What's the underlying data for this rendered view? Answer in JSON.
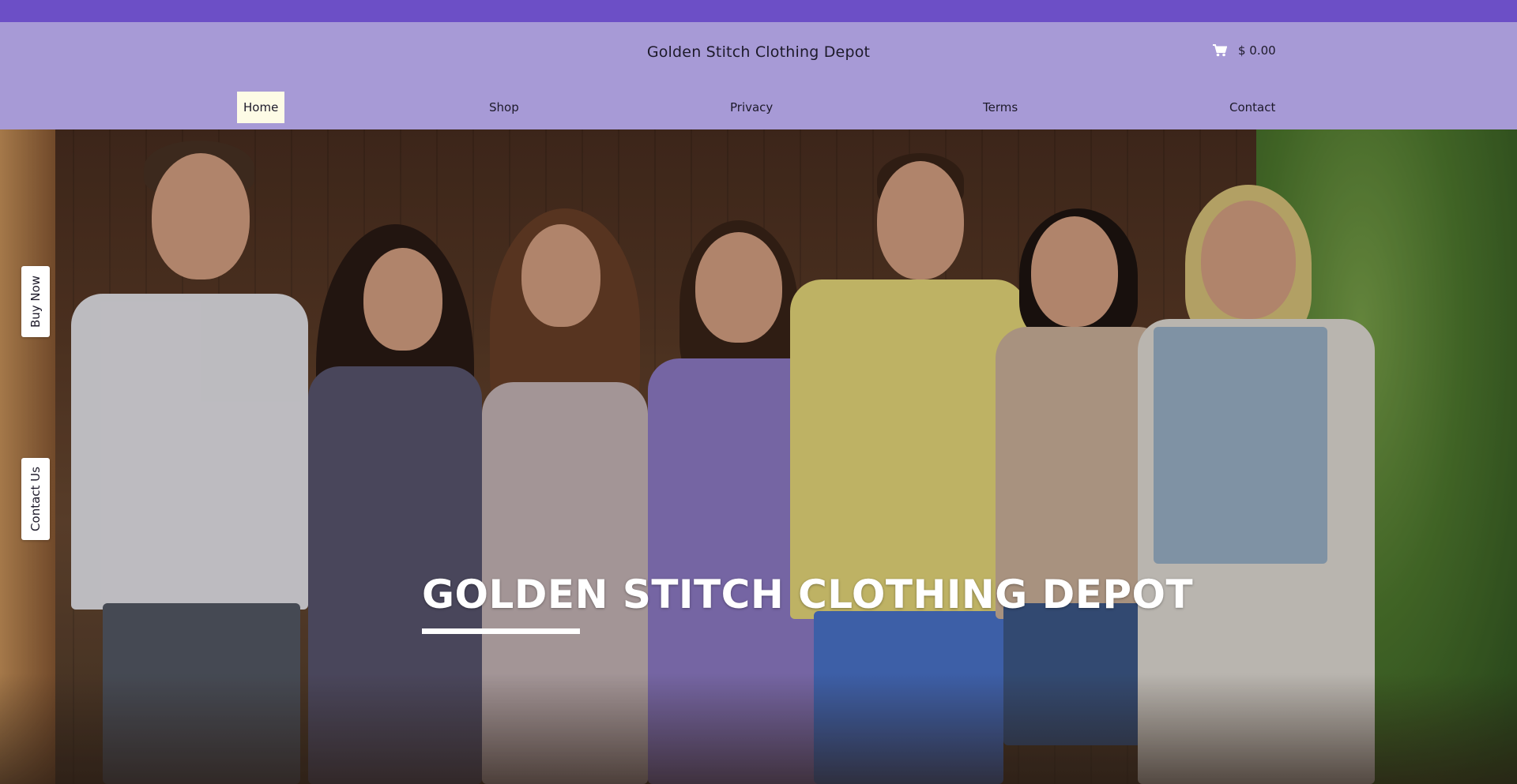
{
  "header": {
    "brand": "Golden Stitch Clothing Depot",
    "cart_total": "$ 0.00",
    "cart_icon": "shopping-cart-icon"
  },
  "nav": {
    "items": [
      {
        "label": "Home",
        "active": true
      },
      {
        "label": "Shop",
        "active": false
      },
      {
        "label": "Privacy",
        "active": false
      },
      {
        "label": "Terms",
        "active": false
      },
      {
        "label": "Contact",
        "active": false
      }
    ]
  },
  "hero": {
    "title": "GOLDEN STITCH CLOTHING DEPOT",
    "image_description": "group of seven smiling friends standing together outdoors"
  },
  "side_tabs": {
    "buy_now": "Buy Now",
    "contact_us": "Contact Us"
  },
  "colors": {
    "topbar": "#6c4fc6",
    "header": "#a79ad6",
    "active_nav": "#fdfbe6",
    "text": "#1d1a2a"
  }
}
